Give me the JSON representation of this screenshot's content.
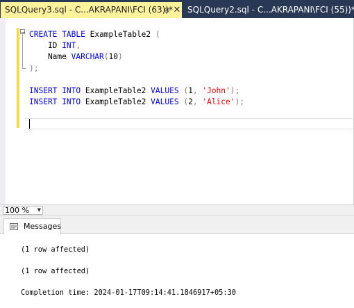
{
  "tabs": [
    {
      "label": "SQLQuery3.sql - C...AKRAPANI\\FCI (63))*",
      "active": true,
      "pin": "⊕",
      "close": "✕"
    },
    {
      "label": "SQLQuery2.sql - C...AKRAPANI\\FCI (55))*",
      "active": false
    }
  ],
  "editor": {
    "lines": [
      [
        {
          "t": "kw",
          "v": "CREATE"
        },
        {
          "t": "",
          "v": " "
        },
        {
          "t": "kw",
          "v": "TABLE"
        },
        {
          "t": "",
          "v": " ExampleTable2 "
        },
        {
          "t": "punc",
          "v": "("
        }
      ],
      [
        {
          "t": "",
          "v": "    ID "
        },
        {
          "t": "kw",
          "v": "INT"
        },
        {
          "t": "punc",
          "v": ","
        }
      ],
      [
        {
          "t": "",
          "v": "    Name "
        },
        {
          "t": "kw",
          "v": "VARCHAR"
        },
        {
          "t": "punc",
          "v": "("
        },
        {
          "t": "",
          "v": "10"
        },
        {
          "t": "punc",
          "v": ")"
        }
      ],
      [
        {
          "t": "punc",
          "v": ");"
        }
      ],
      [
        {
          "t": "",
          "v": ""
        }
      ],
      [
        {
          "t": "kw",
          "v": "INSERT"
        },
        {
          "t": "",
          "v": " "
        },
        {
          "t": "kw",
          "v": "INTO"
        },
        {
          "t": "",
          "v": " ExampleTable2 "
        },
        {
          "t": "kw",
          "v": "VALUES"
        },
        {
          "t": "",
          "v": " "
        },
        {
          "t": "punc",
          "v": "("
        },
        {
          "t": "",
          "v": "1"
        },
        {
          "t": "punc",
          "v": ","
        },
        {
          "t": "",
          "v": " "
        },
        {
          "t": "str",
          "v": "'John'"
        },
        {
          "t": "punc",
          "v": ");"
        }
      ],
      [
        {
          "t": "kw",
          "v": "INSERT"
        },
        {
          "t": "",
          "v": " "
        },
        {
          "t": "kw",
          "v": "INTO"
        },
        {
          "t": "",
          "v": " ExampleTable2 "
        },
        {
          "t": "kw",
          "v": "VALUES"
        },
        {
          "t": "",
          "v": " "
        },
        {
          "t": "punc",
          "v": "("
        },
        {
          "t": "",
          "v": "2"
        },
        {
          "t": "punc",
          "v": ","
        },
        {
          "t": "",
          "v": " "
        },
        {
          "t": "str",
          "v": "'Alice'"
        },
        {
          "t": "punc",
          "v": ");"
        }
      ]
    ],
    "outline_glyph": "−"
  },
  "zoom": {
    "value": "100 %"
  },
  "results": {
    "tab_label": "Messages",
    "messages": [
      "(1 row affected)",
      "(1 row affected)",
      "Completion time: 2024-01-17T09:14:41.1846917+05:30"
    ]
  },
  "colors": {
    "keyword": "#0000ff",
    "string": "#ff0000",
    "punctuation": "#808080",
    "active_tab": "#fff29d",
    "tabstrip": "#293955"
  },
  "icons": [
    "pin-icon",
    "close-icon",
    "collapse-icon",
    "dropdown-arrow-icon",
    "messages-icon"
  ]
}
